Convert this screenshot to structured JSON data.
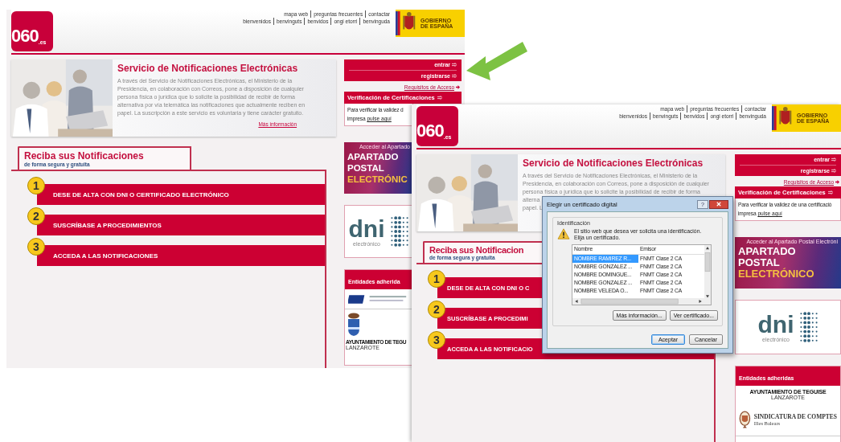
{
  "screenshots": [
    {
      "header": {
        "logo": {
          "number": "060",
          "domain": ".es"
        },
        "links_top": [
          "mapa web",
          "preguntas frecuentes",
          "contactar"
        ],
        "links_bottom": [
          "bienvenidos",
          "benvinguts",
          "benvidos",
          "ongi etorri",
          "benvinguda"
        ],
        "gov_logo": [
          "GOBIERNO",
          "DE ESPAÑA"
        ]
      },
      "intro": {
        "title": "Servicio de Notificaciones Electrónicas",
        "paragraph": [
          "A través del Servicio de Notificaciones Electrónicas, el Ministerio de la",
          "Presidencia, en colaboración con Correos, pone a disposición de cualquier",
          "persona física o jurídica que lo solicite la posibilidad de recibir de forma",
          "alternativa por vía telemática las notificaciones que actualmente reciben en",
          "papel. La suscripción a este servicio es voluntaria y tiene carácter gratuito."
        ],
        "more_link": "Más información"
      },
      "account": {
        "links": [
          "entrar",
          "registrarse"
        ],
        "requirements_link": "Requisitos de Acceso"
      },
      "verification": {
        "title": "Verificación de Certificaciones",
        "text": "Para verificar la validez d",
        "link_prefix": "impresa",
        "link": "pulse aquí"
      },
      "section": {
        "title": "Reciba sus Notificaciones",
        "subtitle": "de forma segura y gratuita",
        "steps": [
          {
            "number": "1",
            "label": "DESE DE ALTA CON DNI O CERTIFICADO ELECTRÓNICO"
          },
          {
            "number": "2",
            "label": "SUSCRÍBASE A PROCEDIMIENTOS"
          },
          {
            "number": "3",
            "label": "ACCEDA A LAS NOTIFICACIONES"
          }
        ]
      },
      "banner": {
        "caption": "Acceder al Apartado",
        "lines": [
          "APARTADO",
          "POSTAL",
          "ELECTRÓNIC"
        ]
      },
      "dni": {
        "mark": "dni",
        "caption": "electrónico"
      },
      "entities": {
        "title": "Entidades adherida",
        "items": [
          {
            "kind": "institute"
          },
          {
            "kind": "municipality",
            "name": "AYUNTAMIENTO DE TEGU",
            "place": "LANZAROTE"
          }
        ]
      }
    },
    {
      "header": {
        "logo": {
          "number": "060",
          "domain": ".es"
        },
        "links_top": [
          "mapa web",
          "preguntas frecuentes",
          "contactar"
        ],
        "links_bottom": [
          "bienvenidos",
          "benvinguts",
          "benvidos",
          "ongi etorri",
          "benvinguda"
        ],
        "gov_logo": [
          "GOBIERNO",
          "DE ESPAÑA"
        ]
      },
      "intro": {
        "title": "Servicio de Notificaciones Electrónicas",
        "paragraph": [
          "A través del Servicio de Notificaciones Electrónicas, el Ministerio de la",
          "Presidencia, en colaboración con Correos, pone a disposición de cualquier",
          "persona física o jurídica que lo solicite la posibilidad de recibir de forma",
          "alterna",
          "papel. L"
        ]
      },
      "account": {
        "links": [
          "entrar",
          "registrarse"
        ],
        "requirements_link": "Requisitos de Acceso"
      },
      "verification": {
        "title": "Verificación de Certificaciones",
        "text": "Para verificar la validez de una certificació",
        "link_prefix": "impresa",
        "link": "pulse aquí"
      },
      "section": {
        "title": "Reciba sus Notificacion",
        "subtitle": "de forma segura y gratuita",
        "steps": [
          {
            "number": "1",
            "label": "DESE DE ALTA CON DNI O C"
          },
          {
            "number": "2",
            "label": "SUSCRÍBASE A PROCEDIMI"
          },
          {
            "number": "3",
            "label": "ACCEDA A LAS NOTIFICACIO"
          }
        ]
      },
      "banner": {
        "caption": "Acceder al Apartado Postal Electróni",
        "lines": [
          "APARTADO",
          "POSTAL",
          "ELECTRÓNICO"
        ]
      },
      "dni": {
        "mark": "dni",
        "caption": "electrónico"
      },
      "entities": {
        "title": "Entidades adheridas",
        "items": [
          {
            "kind": "name_only",
            "name": "AYUNTAMIENTO DE TEGUISE",
            "place": "LANZAROTE"
          },
          {
            "kind": "seal",
            "name": "SINDICATURA DE COMPTES",
            "place": "Illes Balears"
          }
        ]
      },
      "dialog": {
        "title": "Elegir un certificado digital",
        "help": "?",
        "group": "Identificación",
        "message": [
          "El sitio web que desea ver solicita una identificación.",
          "Elija un certificado."
        ],
        "columns": [
          "Nombre",
          "Emisor"
        ],
        "rows": [
          {
            "name": "NOMBRE RAMIREZ R...",
            "issuer": "FNMT Clase 2 CA",
            "selected": true
          },
          {
            "name": "NOMBRE GONZALEZ ...",
            "issuer": "FNMT Clase 2 CA",
            "selected": false
          },
          {
            "name": "NOMBRE DOMINGUE...",
            "issuer": "FNMT Clase 2 CA",
            "selected": false
          },
          {
            "name": "NOMBRE GONZALEZ ...",
            "issuer": "FNMT Clase 2 CA",
            "selected": false
          },
          {
            "name": "NOMBRE VELEDA O...",
            "issuer": "FNMT Clase 2 CA",
            "selected": false
          }
        ],
        "detail_buttons": [
          "Más información...",
          "Ver certificado..."
        ],
        "buttons": [
          {
            "label": "Aceptar",
            "default": true
          },
          {
            "label": "Cancelar",
            "default": false
          }
        ]
      }
    }
  ]
}
